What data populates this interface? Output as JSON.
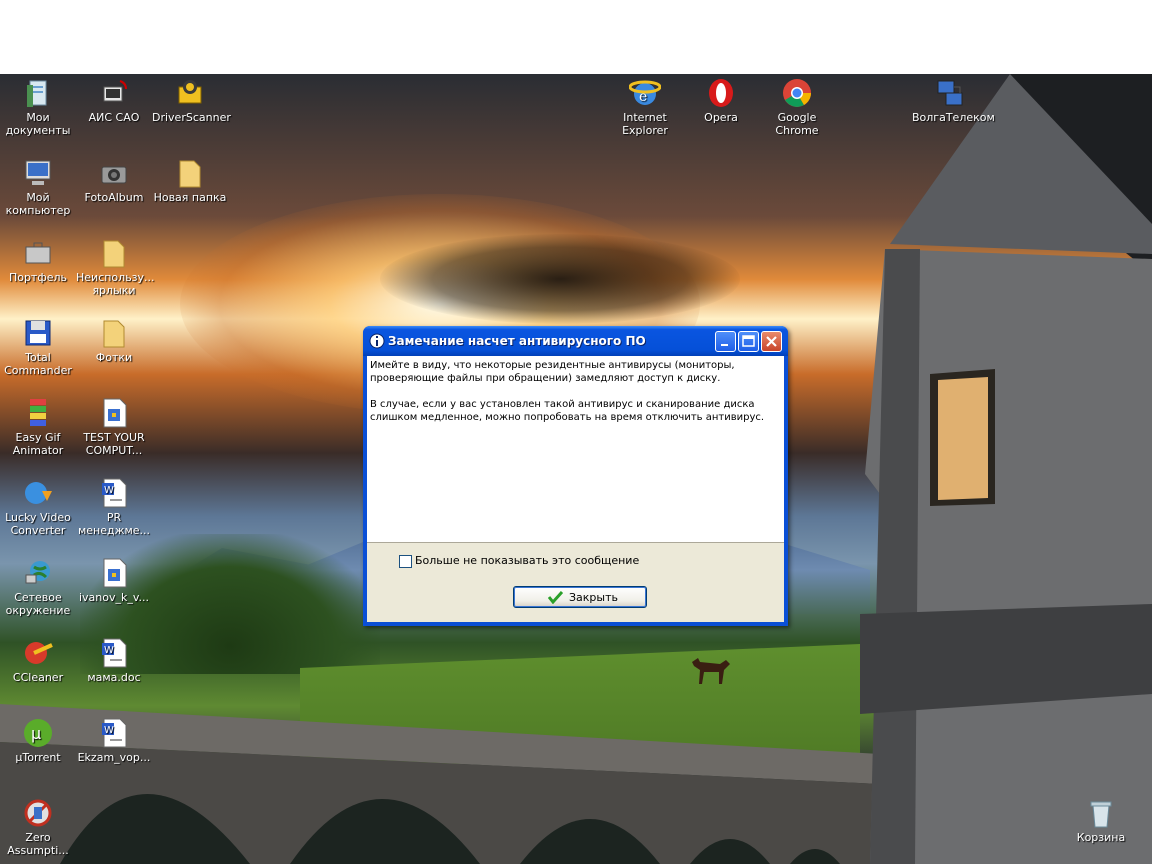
{
  "desktop": {
    "icons": [
      {
        "name": "icon-my-documents",
        "label": "Мои документы",
        "icon": "documents-icon"
      },
      {
        "name": "icon-ais-sao",
        "label": "АИС САО",
        "icon": "network-computer-icon"
      },
      {
        "name": "icon-driverscanner",
        "label": "DriverScanner",
        "icon": "driver-scanner-icon"
      },
      {
        "name": "icon-my-computer",
        "label": "Мой компьютер",
        "icon": "computer-icon"
      },
      {
        "name": "icon-fotoalbum",
        "label": "FotoAlbum",
        "icon": "camera-icon"
      },
      {
        "name": "icon-new-folder",
        "label": "Новая папка",
        "icon": "folder-icon"
      },
      {
        "name": "icon-briefcase",
        "label": "Портфель",
        "icon": "briefcase-icon"
      },
      {
        "name": "icon-unused-shortcuts",
        "label": "Неиспользу... ярлыки",
        "icon": "folder-icon"
      },
      {
        "name": "icon-total-commander",
        "label": "Total Commander",
        "icon": "floppy-icon"
      },
      {
        "name": "icon-fotki",
        "label": "Фотки",
        "icon": "folder-icon"
      },
      {
        "name": "icon-easy-gif",
        "label": "Easy Gif Animator",
        "icon": "easy-gif-icon"
      },
      {
        "name": "icon-test-your-computer",
        "label": "TEST YOUR COMPUT...",
        "icon": "wordpad-doc-icon"
      },
      {
        "name": "icon-lucky-video",
        "label": "Lucky Video Converter",
        "icon": "lucky-video-icon"
      },
      {
        "name": "icon-pr-manager",
        "label": "PR менеджме...",
        "icon": "word-doc-icon"
      },
      {
        "name": "icon-network",
        "label": "Сетевое окружение",
        "icon": "network-globe-icon"
      },
      {
        "name": "icon-ivanov",
        "label": "ivanov_k_v...",
        "icon": "wordpad-doc-icon"
      },
      {
        "name": "icon-ccleaner",
        "label": "CCleaner",
        "icon": "ccleaner-icon"
      },
      {
        "name": "icon-mama-doc",
        "label": "мама.doc",
        "icon": "word-doc-icon"
      },
      {
        "name": "icon-utorrent",
        "label": "µTorrent",
        "icon": "utorrent-icon"
      },
      {
        "name": "icon-ekzam",
        "label": "Ekzam_vop...",
        "icon": "word-doc-icon"
      },
      {
        "name": "icon-zero-assumption",
        "label": "Zero Assumpti...",
        "icon": "zero-assumption-icon"
      },
      {
        "name": "icon-internet-explorer",
        "label": "Internet Explorer",
        "icon": "internet-explorer-icon"
      },
      {
        "name": "icon-opera",
        "label": "Opera",
        "icon": "opera-icon"
      },
      {
        "name": "icon-google-chrome",
        "label": "Google Chrome",
        "icon": "chrome-icon"
      },
      {
        "name": "icon-volgatelecom",
        "label": "ВолгаТелеком",
        "icon": "network-connection-icon"
      },
      {
        "name": "icon-recycle-bin",
        "label": "Корзина",
        "icon": "recycle-bin-icon"
      }
    ]
  },
  "dialog": {
    "title": "Замечание насчет антивирусного ПО",
    "paragraph1_line1": "Имейте в виду, что некоторые резидентные антивирусы (мониторы,",
    "paragraph1_line2": "проверяющие файлы при обращении) замедляют доступ к диску.",
    "paragraph2_line1": "В случае, если у вас установлен такой антивирус и сканирование диска",
    "paragraph2_line2": "слишком медленное, можно попробовать на время отключить антивирус.",
    "checkbox_label": "Больше не показывать это сообщение",
    "checkbox_checked": false,
    "close_button_label": "Закрыть"
  },
  "colors": {
    "titlebar": "#0550d8",
    "dialog_face": "#ece9d8",
    "close_button": "#c8442a"
  }
}
